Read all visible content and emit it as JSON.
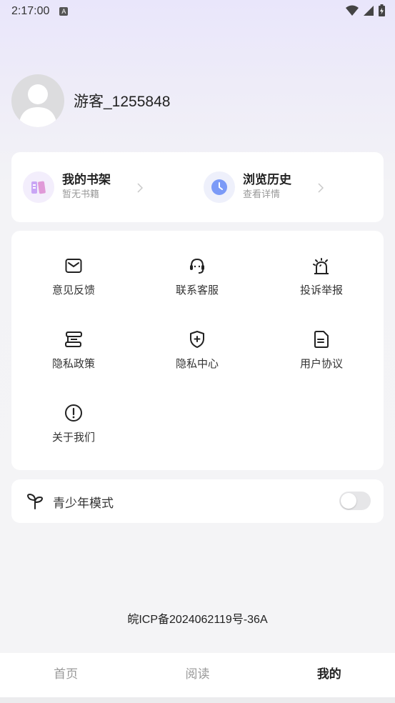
{
  "status_bar": {
    "time": "2:17:00"
  },
  "profile": {
    "username": "游客_1255848"
  },
  "shelf": {
    "bookshelf": {
      "title": "我的书架",
      "subtitle": "暂无书籍"
    },
    "history": {
      "title": "浏览历史",
      "subtitle": "查看详情"
    }
  },
  "menu": [
    {
      "label": "意见反馈",
      "icon": "mail-icon"
    },
    {
      "label": "联系客服",
      "icon": "headset-icon"
    },
    {
      "label": "投诉举报",
      "icon": "alarm-icon"
    },
    {
      "label": "隐私政策",
      "icon": "scroll-icon"
    },
    {
      "label": "隐私中心",
      "icon": "shield-plus-icon"
    },
    {
      "label": "用户协议",
      "icon": "document-icon"
    },
    {
      "label": "关于我们",
      "icon": "info-circle-icon"
    }
  ],
  "teen_mode": {
    "label": "青少年模式",
    "enabled": false
  },
  "icp": "皖ICP备2024062119号-36A",
  "tabs": [
    {
      "label": "首页",
      "active": false
    },
    {
      "label": "阅读",
      "active": false
    },
    {
      "label": "我的",
      "active": true
    }
  ],
  "colors": {
    "accent_purple": "#b48cf0",
    "accent_blue": "#6f8ff5"
  }
}
